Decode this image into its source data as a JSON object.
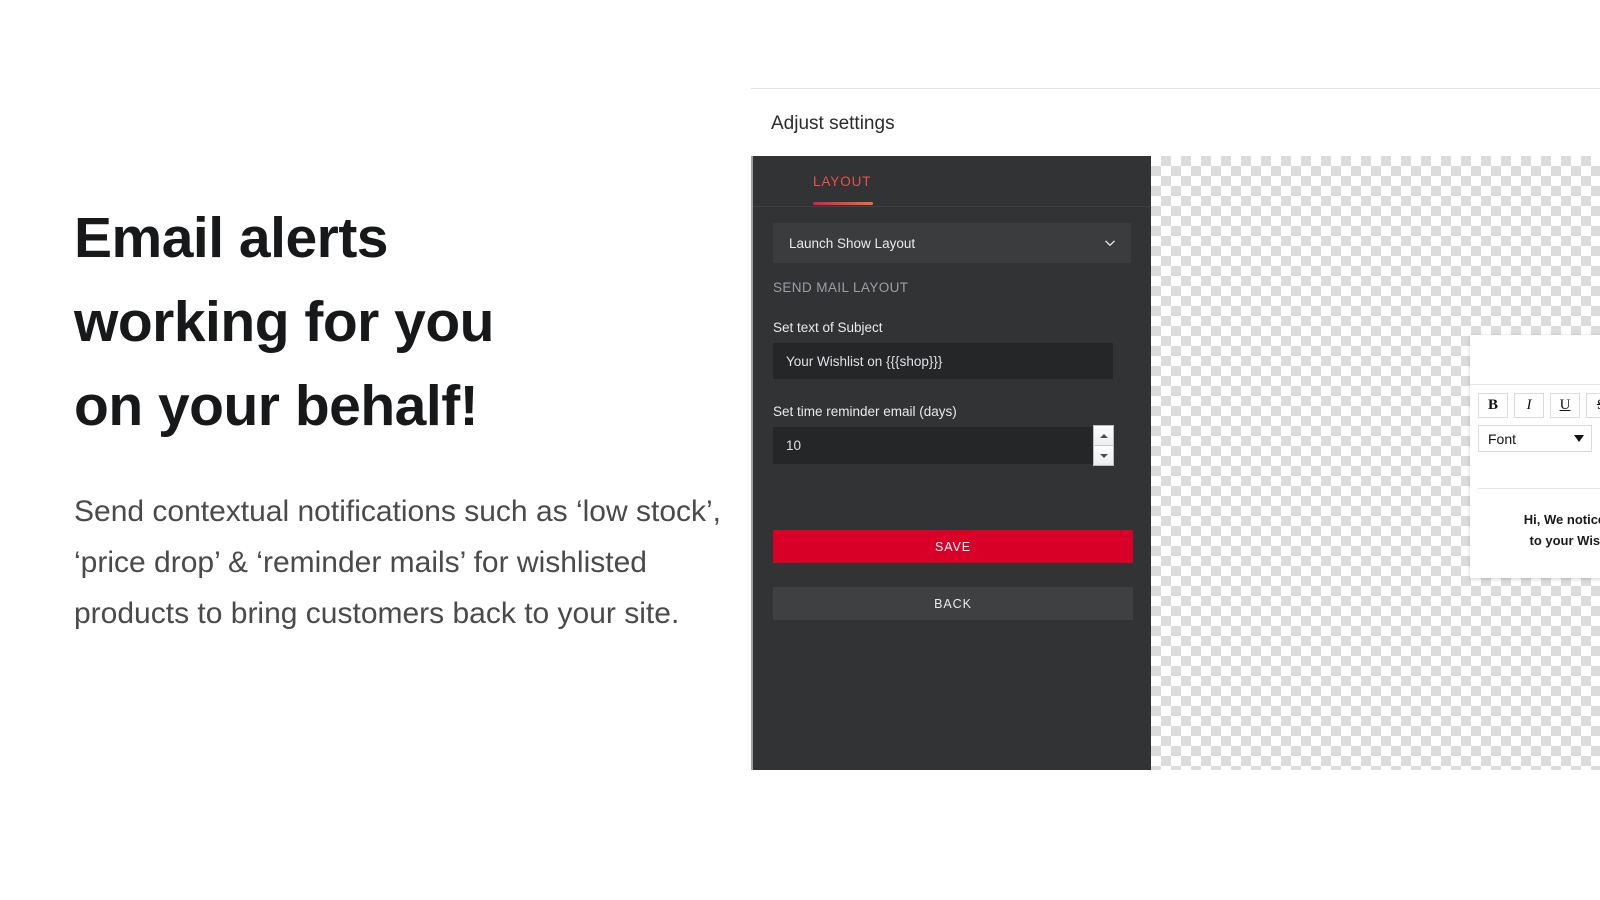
{
  "hero": {
    "headline_lines": [
      "Email alerts",
      "working for you",
      "on your behalf!"
    ],
    "subcopy": "Send contextual notifications such as ‘low stock’, ‘price drop’ & ‘reminder mails’ for wishlisted products to bring customers back to your site."
  },
  "screenshot": {
    "title": "Adjust settings",
    "panel": {
      "tab": {
        "label": "LAYOUT",
        "accent_start": "#e01b4c",
        "accent_end": "#ef6d3a",
        "text_color": "#e8524a"
      },
      "select": {
        "value": "Launch Show Layout",
        "icon": "chevron-down-icon"
      },
      "caption": "SEND MAIL LAYOUT",
      "subject": {
        "label": "Set text of Subject",
        "value": "Your Wishlist on {{{shop}}}"
      },
      "reminder": {
        "label": "Set time reminder email (days)",
        "value": "10"
      },
      "save_label": "SAVE",
      "back_label": "BACK",
      "save_color": "#d80027",
      "panel_bg": "#313335"
    },
    "editor": {
      "toolbar": {
        "bold": "B",
        "italic": "I",
        "underline": "U",
        "strike": "S",
        "font_label": "Font",
        "pencil_icon": "pencil-icon",
        "link_icon": "link-icon"
      },
      "body_line1": "Hi, We noticed tha",
      "body_line2": "to your Wishlist."
    }
  }
}
